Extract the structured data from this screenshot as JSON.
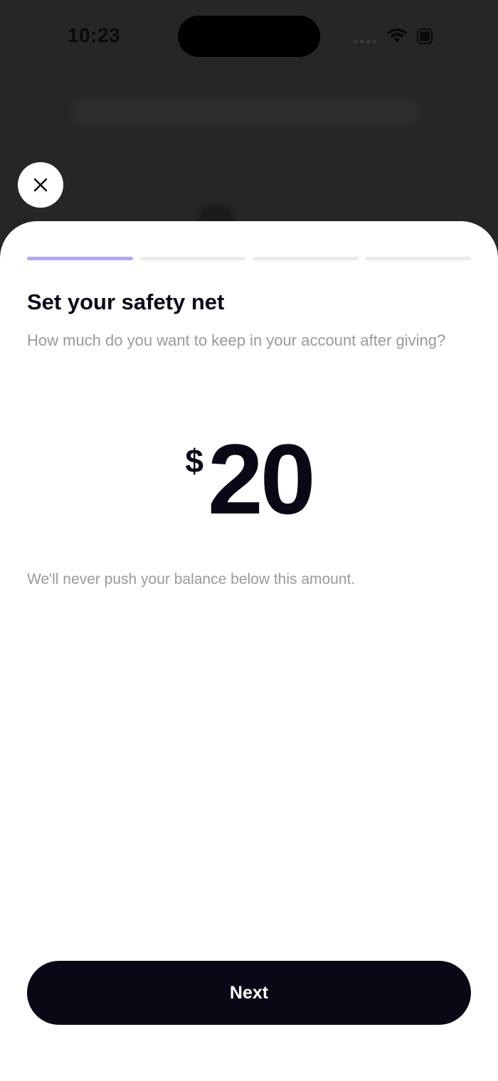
{
  "status_bar": {
    "time": "10:23",
    "wifi_icon": "wifi-icon",
    "battery_icon": "battery-icon"
  },
  "close_button": {
    "icon": "close-icon"
  },
  "progress": {
    "total_steps": 4,
    "current_step": 1,
    "active_color": "#b7a8f5",
    "inactive_color": "#ebebeb"
  },
  "sheet": {
    "title": "Set your safety net",
    "subtitle": "How much do you want to keep in your account after giving?",
    "amount": {
      "currency": "$",
      "value": "20"
    },
    "hint": "We'll never push your balance below this amount.",
    "next_label": "Next"
  },
  "colors": {
    "primary": "#0a0814",
    "muted_text": "#9a9a9a",
    "backdrop": "#262626"
  }
}
